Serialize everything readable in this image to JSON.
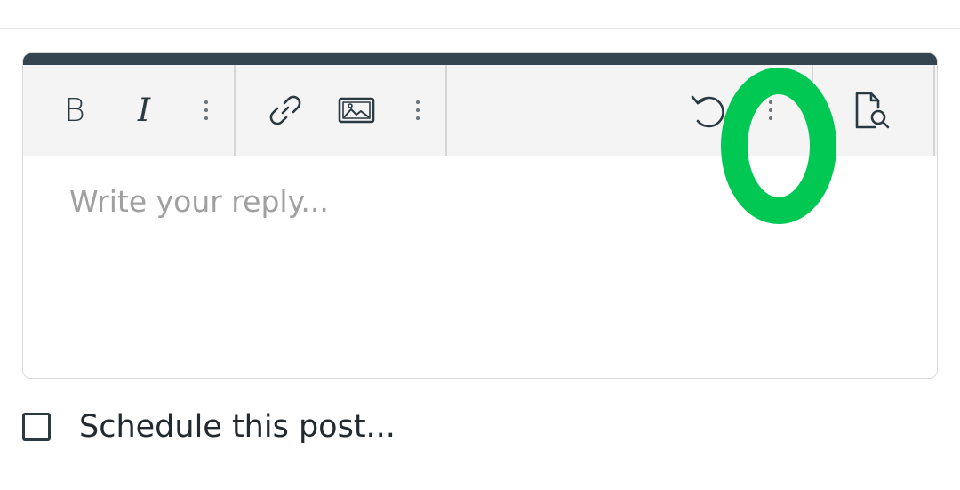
{
  "editor": {
    "toolbar": {
      "buttons": [
        {
          "name": "bold",
          "glyph": "B",
          "icon": "bold-icon"
        },
        {
          "name": "italic",
          "glyph": "I",
          "icon": "italic-icon"
        },
        {
          "name": "more-format",
          "icon": "more-vertical-icon"
        },
        {
          "name": "link",
          "icon": "link-icon"
        },
        {
          "name": "image",
          "icon": "image-icon"
        },
        {
          "name": "more-insert",
          "icon": "more-vertical-icon"
        },
        {
          "name": "undo",
          "icon": "undo-icon"
        },
        {
          "name": "more-options",
          "icon": "more-vertical-icon"
        },
        {
          "name": "preview",
          "icon": "preview-icon"
        }
      ]
    },
    "reply_placeholder": "Write your reply...",
    "accent_color": "#354550"
  },
  "schedule": {
    "label": "Schedule this post...",
    "checked": false
  },
  "annotation": {
    "color": "#00c853",
    "shape": "ellipse"
  }
}
